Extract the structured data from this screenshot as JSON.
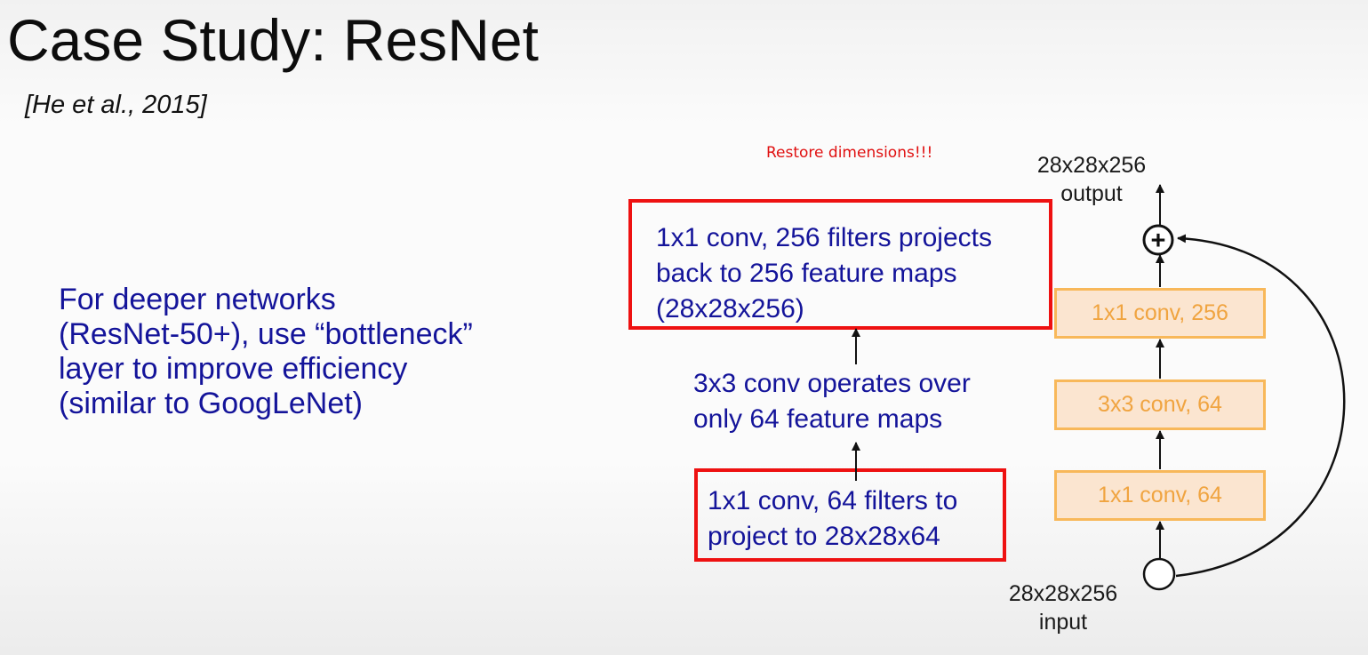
{
  "slide": {
    "title": "Case Study: ResNet",
    "citation": "[He et al., 2015]",
    "description_lines": [
      "For deeper networks",
      "(ResNet-50+), use “bottleneck”",
      "layer to improve efficiency",
      "(similar to GoogLeNet)"
    ]
  },
  "annotation": {
    "text": "Restore dimensions!!!",
    "color": "#e01010"
  },
  "callouts": {
    "top_lines": [
      "1x1 conv, 256 filters projects",
      "back to 256 feature maps",
      "(28x28x256)"
    ],
    "middle_lines": [
      "3x3 conv operates over",
      "only 64 feature maps"
    ],
    "bottom_lines": [
      "1x1 conv, 64 filters to",
      "project to 28x28x64"
    ]
  },
  "block": {
    "output_dim": "28x28x256",
    "output_label": "output",
    "input_dim": "28x28x256",
    "input_label": "input",
    "layers": [
      "1x1 conv, 256",
      "3x3 conv, 64",
      "1x1 conv, 64"
    ],
    "add_symbol": "+"
  },
  "colors": {
    "text_blue": "#14149a",
    "highlight_red": "#ee1111",
    "layer_fill": "#fbe5d0",
    "layer_border": "#f8b85a",
    "layer_text": "#f0a440"
  }
}
